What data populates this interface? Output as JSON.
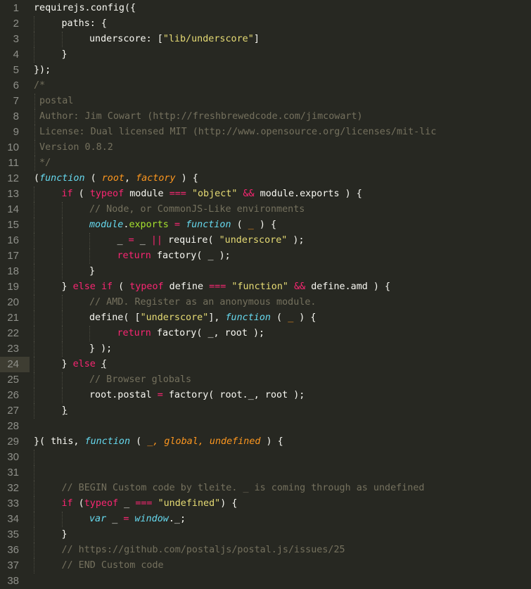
{
  "editor": {
    "theme": {
      "background": "#272822",
      "foreground": "#f8f8f2",
      "keyword": "#f92672",
      "string": "#e6db74",
      "storage": "#66d9ef",
      "parameter": "#fd971f",
      "comment": "#75715e",
      "property": "#a6e22e",
      "gutter_text": "#8f908a",
      "active_gutter": "#3e3d32"
    },
    "active_line": 24,
    "lines": [
      {
        "n": "1",
        "indent": 0,
        "tokens": [
          [
            "pl",
            "requirejs.config({"
          ]
        ]
      },
      {
        "n": "2",
        "indent": 1,
        "tokens": [
          [
            "pl",
            "paths: {"
          ]
        ]
      },
      {
        "n": "3",
        "indent": 2,
        "tokens": [
          [
            "pl",
            "underscore: ["
          ],
          [
            "st",
            "\"lib/underscore\""
          ],
          [
            "pl",
            "]"
          ]
        ]
      },
      {
        "n": "4",
        "indent": 1,
        "tokens": [
          [
            "pl",
            "}"
          ]
        ]
      },
      {
        "n": "5",
        "indent": 0,
        "tokens": [
          [
            "pl",
            "});"
          ]
        ]
      },
      {
        "n": "6",
        "indent": 0,
        "tokens": [
          [
            "cm",
            "/*"
          ]
        ]
      },
      {
        "n": "7",
        "indent": 0,
        "tokens": [
          [
            "cm",
            " postal"
          ]
        ]
      },
      {
        "n": "8",
        "indent": 0,
        "tokens": [
          [
            "cm",
            " Author: Jim Cowart (http://freshbrewedcode.com/jimcowart)"
          ]
        ]
      },
      {
        "n": "9",
        "indent": 0,
        "tokens": [
          [
            "cm",
            " License: Dual licensed MIT (http://www.opensource.org/licenses/mit-lic"
          ]
        ]
      },
      {
        "n": "10",
        "indent": 0,
        "tokens": [
          [
            "cm",
            " Version 0.8.2"
          ]
        ]
      },
      {
        "n": "11",
        "indent": 0,
        "tokens": [
          [
            "cm",
            " */"
          ]
        ]
      },
      {
        "n": "12",
        "indent": 0,
        "tokens": [
          [
            "pl",
            "("
          ],
          [
            "sf",
            "function"
          ],
          [
            "pl",
            " ( "
          ],
          [
            "pa",
            "root"
          ],
          [
            "pl",
            ", "
          ],
          [
            "pa",
            "factory"
          ],
          [
            "pl",
            " ) {"
          ]
        ]
      },
      {
        "n": "13",
        "indent": 1,
        "tokens": [
          [
            "kw",
            "if"
          ],
          [
            "pl",
            " ( "
          ],
          [
            "kw",
            "typeof"
          ],
          [
            "pl",
            " module "
          ],
          [
            "op",
            "==="
          ],
          [
            "pl",
            " "
          ],
          [
            "st",
            "\"object\""
          ],
          [
            "pl",
            " "
          ],
          [
            "op",
            "&&"
          ],
          [
            "pl",
            " module.exports ) {"
          ]
        ]
      },
      {
        "n": "14",
        "indent": 2,
        "tokens": [
          [
            "cm",
            "// Node, or CommonJS-Like environments"
          ]
        ]
      },
      {
        "n": "15",
        "indent": 2,
        "tokens": [
          [
            "sf",
            "module"
          ],
          [
            "pl",
            "."
          ],
          [
            "fn",
            "exports"
          ],
          [
            "pl",
            " "
          ],
          [
            "op",
            "="
          ],
          [
            "pl",
            " "
          ],
          [
            "sf",
            "function"
          ],
          [
            "pl",
            " ( "
          ],
          [
            "pa",
            "_"
          ],
          [
            "pl",
            " ) {"
          ]
        ]
      },
      {
        "n": "16",
        "indent": 3,
        "tokens": [
          [
            "pl",
            "_ "
          ],
          [
            "op",
            "="
          ],
          [
            "pl",
            " _ "
          ],
          [
            "op",
            "||"
          ],
          [
            "pl",
            " require( "
          ],
          [
            "st",
            "\"underscore\""
          ],
          [
            "pl",
            " );"
          ]
        ]
      },
      {
        "n": "17",
        "indent": 3,
        "tokens": [
          [
            "kw",
            "return"
          ],
          [
            "pl",
            " factory( _ );"
          ]
        ]
      },
      {
        "n": "18",
        "indent": 2,
        "tokens": [
          [
            "pl",
            "}"
          ]
        ]
      },
      {
        "n": "19",
        "indent": 1,
        "tokens": [
          [
            "pl",
            "} "
          ],
          [
            "kw",
            "else"
          ],
          [
            "pl",
            " "
          ],
          [
            "kw",
            "if"
          ],
          [
            "pl",
            " ( "
          ],
          [
            "kw",
            "typeof"
          ],
          [
            "pl",
            " define "
          ],
          [
            "op",
            "==="
          ],
          [
            "pl",
            " "
          ],
          [
            "st",
            "\"function\""
          ],
          [
            "pl",
            " "
          ],
          [
            "op",
            "&&"
          ],
          [
            "pl",
            " define.amd ) {"
          ]
        ]
      },
      {
        "n": "20",
        "indent": 2,
        "tokens": [
          [
            "cm",
            "// AMD. Register as an anonymous module."
          ]
        ]
      },
      {
        "n": "21",
        "indent": 2,
        "tokens": [
          [
            "pl",
            "define( ["
          ],
          [
            "st",
            "\"underscore\""
          ],
          [
            "pl",
            "], "
          ],
          [
            "sf",
            "function"
          ],
          [
            "pl",
            " ( "
          ],
          [
            "pa",
            "_"
          ],
          [
            "pl",
            " ) {"
          ]
        ]
      },
      {
        "n": "22",
        "indent": 3,
        "tokens": [
          [
            "kw",
            "return"
          ],
          [
            "pl",
            " factory( _, root );"
          ]
        ]
      },
      {
        "n": "23",
        "indent": 2,
        "tokens": [
          [
            "pl",
            "} );"
          ]
        ]
      },
      {
        "n": "24",
        "indent": 1,
        "tokens": [
          [
            "pl",
            "} "
          ],
          [
            "kw",
            "else"
          ],
          [
            "pl",
            " "
          ],
          [
            "ul",
            "{"
          ]
        ]
      },
      {
        "n": "25",
        "indent": 2,
        "tokens": [
          [
            "cm",
            "// Browser globals"
          ]
        ]
      },
      {
        "n": "26",
        "indent": 2,
        "tokens": [
          [
            "pl",
            "root.postal "
          ],
          [
            "op",
            "="
          ],
          [
            "pl",
            " factory( root._, root );"
          ]
        ]
      },
      {
        "n": "27",
        "indent": 1,
        "tokens": [
          [
            "ul",
            "}"
          ]
        ]
      },
      {
        "n": "28",
        "indent": 0,
        "tokens": []
      },
      {
        "n": "29",
        "indent": 0,
        "tokens": [
          [
            "pl",
            "}( this, "
          ],
          [
            "sf",
            "function"
          ],
          [
            "pl",
            " ( "
          ],
          [
            "pa",
            "_, global, undefined"
          ],
          [
            "pl",
            " ) {"
          ]
        ]
      },
      {
        "n": "30",
        "indent": 0,
        "tokens": []
      },
      {
        "n": "31",
        "indent": 0,
        "tokens": []
      },
      {
        "n": "32",
        "indent": 1,
        "tokens": [
          [
            "cm",
            "// BEGIN Custom code by tleite. _ is coming through as undefined"
          ]
        ]
      },
      {
        "n": "33",
        "indent": 1,
        "tokens": [
          [
            "kw",
            "if"
          ],
          [
            "pl",
            " ("
          ],
          [
            "kw",
            "typeof"
          ],
          [
            "pl",
            " _ "
          ],
          [
            "op",
            "==="
          ],
          [
            "pl",
            " "
          ],
          [
            "st",
            "\"undefined\""
          ],
          [
            "pl",
            ") {"
          ]
        ]
      },
      {
        "n": "34",
        "indent": 2,
        "tokens": [
          [
            "sf",
            "var"
          ],
          [
            "pl",
            " _ "
          ],
          [
            "op",
            "="
          ],
          [
            "pl",
            " "
          ],
          [
            "sf",
            "window"
          ],
          [
            "pl",
            "._;"
          ]
        ]
      },
      {
        "n": "35",
        "indent": 1,
        "tokens": [
          [
            "pl",
            "}"
          ]
        ]
      },
      {
        "n": "36",
        "indent": 1,
        "tokens": [
          [
            "cm",
            "// https://github.com/postaljs/postal.js/issues/25"
          ]
        ]
      },
      {
        "n": "37",
        "indent": 1,
        "tokens": [
          [
            "cm",
            "// END Custom code"
          ]
        ]
      },
      {
        "n": "38",
        "indent": 0,
        "tokens": []
      }
    ]
  }
}
